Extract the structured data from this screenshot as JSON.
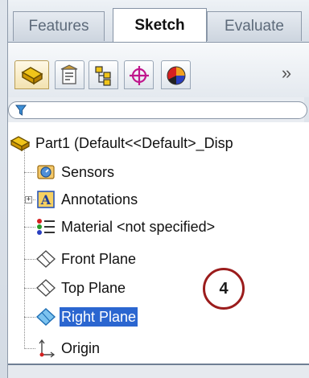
{
  "command_manager": {
    "tabs": [
      {
        "label": "Features"
      },
      {
        "label": "Sketch",
        "active": true
      },
      {
        "label": "Evaluate"
      }
    ]
  },
  "feature_manager": {
    "tabs": [
      {
        "icon": "feature-tree-icon"
      },
      {
        "icon": "property-manager-icon"
      },
      {
        "icon": "configuration-manager-icon"
      },
      {
        "icon": "dimxpert-icon"
      },
      {
        "icon": "display-manager-icon"
      }
    ],
    "overflow": "»",
    "filter_icon": "filter-funnel-icon"
  },
  "tree": {
    "root": "Part1  (Default<<Default>_Disp",
    "items": [
      {
        "label": "Sensors",
        "icon": "sensors-icon"
      },
      {
        "label": "Annotations",
        "icon": "annotations-icon",
        "expandable": true
      },
      {
        "label": "Material <not specified>",
        "icon": "material-icon"
      },
      {
        "label": "Front Plane",
        "icon": "plane-icon"
      },
      {
        "label": "Top Plane",
        "icon": "plane-icon"
      },
      {
        "label": "Right Plane",
        "icon": "plane-icon",
        "selected": true
      },
      {
        "label": "Origin",
        "icon": "origin-icon"
      }
    ]
  },
  "callout": {
    "label": "4",
    "color": "#9b1c1c"
  },
  "colors": {
    "selection": "#2b66d0"
  }
}
